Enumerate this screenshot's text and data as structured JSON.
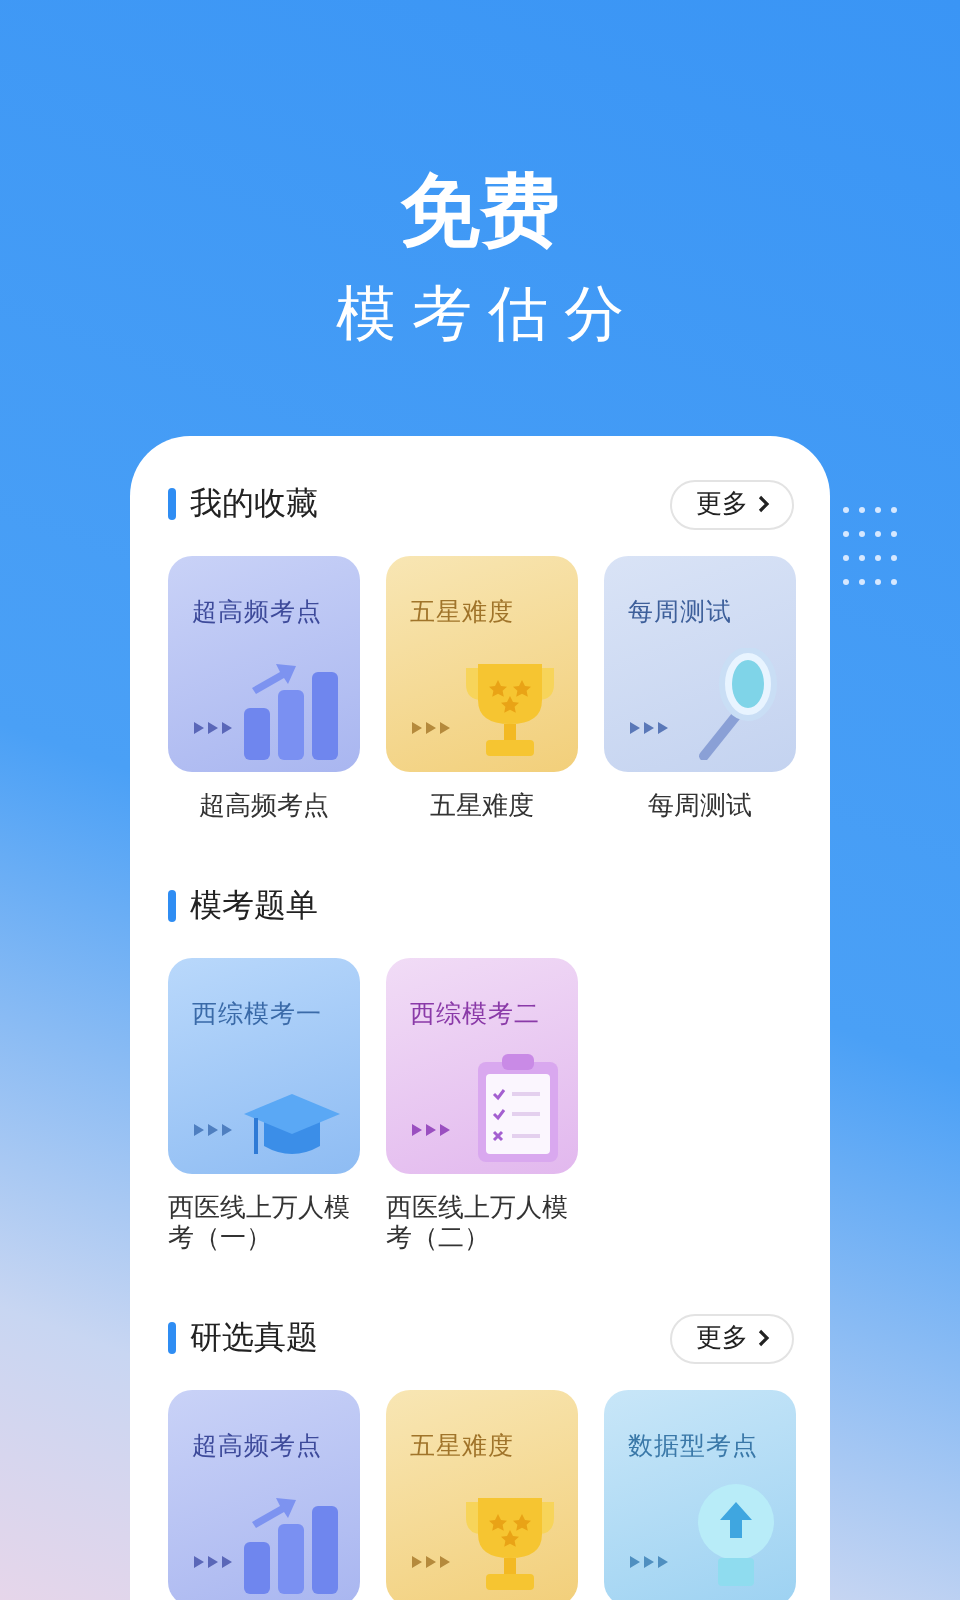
{
  "hero": {
    "title": "免费",
    "subtitle": "模考估分"
  },
  "sections": [
    {
      "title": "我的收藏",
      "more": "更多",
      "items": [
        {
          "kind": "chart",
          "tile_title": "超高频考点",
          "label": "超高频考点"
        },
        {
          "kind": "trophy",
          "tile_title": "五星难度",
          "label": "五星难度"
        },
        {
          "kind": "magnifier",
          "tile_title": "每周测试",
          "label": "每周测试"
        }
      ]
    },
    {
      "title": "模考题单",
      "items": [
        {
          "kind": "cap",
          "tile_title": "西综模考一",
          "label": "西医线上万人模考（一）"
        },
        {
          "kind": "clipboard",
          "tile_title": "西综模考二",
          "label": "西医线上万人模考（二）"
        }
      ]
    },
    {
      "title": "研选真题",
      "more": "更多",
      "items": [
        {
          "kind": "chart",
          "tile_title": "超高频考点"
        },
        {
          "kind": "trophy",
          "tile_title": "五星难度"
        },
        {
          "kind": "bulb",
          "tile_title": "数据型考点"
        }
      ]
    }
  ]
}
